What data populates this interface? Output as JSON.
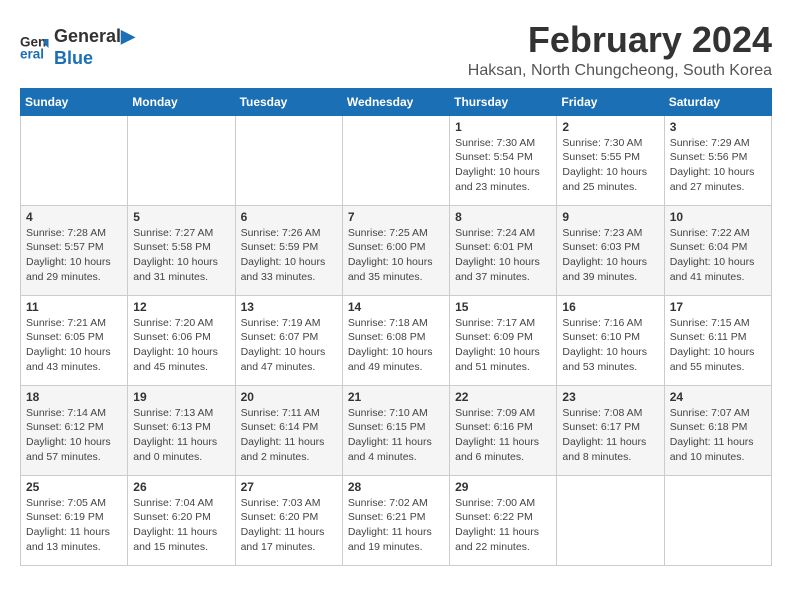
{
  "header": {
    "logo_line1": "General",
    "logo_line2": "Blue",
    "month_year": "February 2024",
    "location": "Haksan, North Chungcheong, South Korea"
  },
  "weekdays": [
    "Sunday",
    "Monday",
    "Tuesday",
    "Wednesday",
    "Thursday",
    "Friday",
    "Saturday"
  ],
  "weeks": [
    [
      {
        "day": "",
        "info": ""
      },
      {
        "day": "",
        "info": ""
      },
      {
        "day": "",
        "info": ""
      },
      {
        "day": "",
        "info": ""
      },
      {
        "day": "1",
        "info": "Sunrise: 7:30 AM\nSunset: 5:54 PM\nDaylight: 10 hours\nand 23 minutes."
      },
      {
        "day": "2",
        "info": "Sunrise: 7:30 AM\nSunset: 5:55 PM\nDaylight: 10 hours\nand 25 minutes."
      },
      {
        "day": "3",
        "info": "Sunrise: 7:29 AM\nSunset: 5:56 PM\nDaylight: 10 hours\nand 27 minutes."
      }
    ],
    [
      {
        "day": "4",
        "info": "Sunrise: 7:28 AM\nSunset: 5:57 PM\nDaylight: 10 hours\nand 29 minutes."
      },
      {
        "day": "5",
        "info": "Sunrise: 7:27 AM\nSunset: 5:58 PM\nDaylight: 10 hours\nand 31 minutes."
      },
      {
        "day": "6",
        "info": "Sunrise: 7:26 AM\nSunset: 5:59 PM\nDaylight: 10 hours\nand 33 minutes."
      },
      {
        "day": "7",
        "info": "Sunrise: 7:25 AM\nSunset: 6:00 PM\nDaylight: 10 hours\nand 35 minutes."
      },
      {
        "day": "8",
        "info": "Sunrise: 7:24 AM\nSunset: 6:01 PM\nDaylight: 10 hours\nand 37 minutes."
      },
      {
        "day": "9",
        "info": "Sunrise: 7:23 AM\nSunset: 6:03 PM\nDaylight: 10 hours\nand 39 minutes."
      },
      {
        "day": "10",
        "info": "Sunrise: 7:22 AM\nSunset: 6:04 PM\nDaylight: 10 hours\nand 41 minutes."
      }
    ],
    [
      {
        "day": "11",
        "info": "Sunrise: 7:21 AM\nSunset: 6:05 PM\nDaylight: 10 hours\nand 43 minutes."
      },
      {
        "day": "12",
        "info": "Sunrise: 7:20 AM\nSunset: 6:06 PM\nDaylight: 10 hours\nand 45 minutes."
      },
      {
        "day": "13",
        "info": "Sunrise: 7:19 AM\nSunset: 6:07 PM\nDaylight: 10 hours\nand 47 minutes."
      },
      {
        "day": "14",
        "info": "Sunrise: 7:18 AM\nSunset: 6:08 PM\nDaylight: 10 hours\nand 49 minutes."
      },
      {
        "day": "15",
        "info": "Sunrise: 7:17 AM\nSunset: 6:09 PM\nDaylight: 10 hours\nand 51 minutes."
      },
      {
        "day": "16",
        "info": "Sunrise: 7:16 AM\nSunset: 6:10 PM\nDaylight: 10 hours\nand 53 minutes."
      },
      {
        "day": "17",
        "info": "Sunrise: 7:15 AM\nSunset: 6:11 PM\nDaylight: 10 hours\nand 55 minutes."
      }
    ],
    [
      {
        "day": "18",
        "info": "Sunrise: 7:14 AM\nSunset: 6:12 PM\nDaylight: 10 hours\nand 57 minutes."
      },
      {
        "day": "19",
        "info": "Sunrise: 7:13 AM\nSunset: 6:13 PM\nDaylight: 11 hours\nand 0 minutes."
      },
      {
        "day": "20",
        "info": "Sunrise: 7:11 AM\nSunset: 6:14 PM\nDaylight: 11 hours\nand 2 minutes."
      },
      {
        "day": "21",
        "info": "Sunrise: 7:10 AM\nSunset: 6:15 PM\nDaylight: 11 hours\nand 4 minutes."
      },
      {
        "day": "22",
        "info": "Sunrise: 7:09 AM\nSunset: 6:16 PM\nDaylight: 11 hours\nand 6 minutes."
      },
      {
        "day": "23",
        "info": "Sunrise: 7:08 AM\nSunset: 6:17 PM\nDaylight: 11 hours\nand 8 minutes."
      },
      {
        "day": "24",
        "info": "Sunrise: 7:07 AM\nSunset: 6:18 PM\nDaylight: 11 hours\nand 10 minutes."
      }
    ],
    [
      {
        "day": "25",
        "info": "Sunrise: 7:05 AM\nSunset: 6:19 PM\nDaylight: 11 hours\nand 13 minutes."
      },
      {
        "day": "26",
        "info": "Sunrise: 7:04 AM\nSunset: 6:20 PM\nDaylight: 11 hours\nand 15 minutes."
      },
      {
        "day": "27",
        "info": "Sunrise: 7:03 AM\nSunset: 6:20 PM\nDaylight: 11 hours\nand 17 minutes."
      },
      {
        "day": "28",
        "info": "Sunrise: 7:02 AM\nSunset: 6:21 PM\nDaylight: 11 hours\nand 19 minutes."
      },
      {
        "day": "29",
        "info": "Sunrise: 7:00 AM\nSunset: 6:22 PM\nDaylight: 11 hours\nand 22 minutes."
      },
      {
        "day": "",
        "info": ""
      },
      {
        "day": "",
        "info": ""
      }
    ]
  ]
}
